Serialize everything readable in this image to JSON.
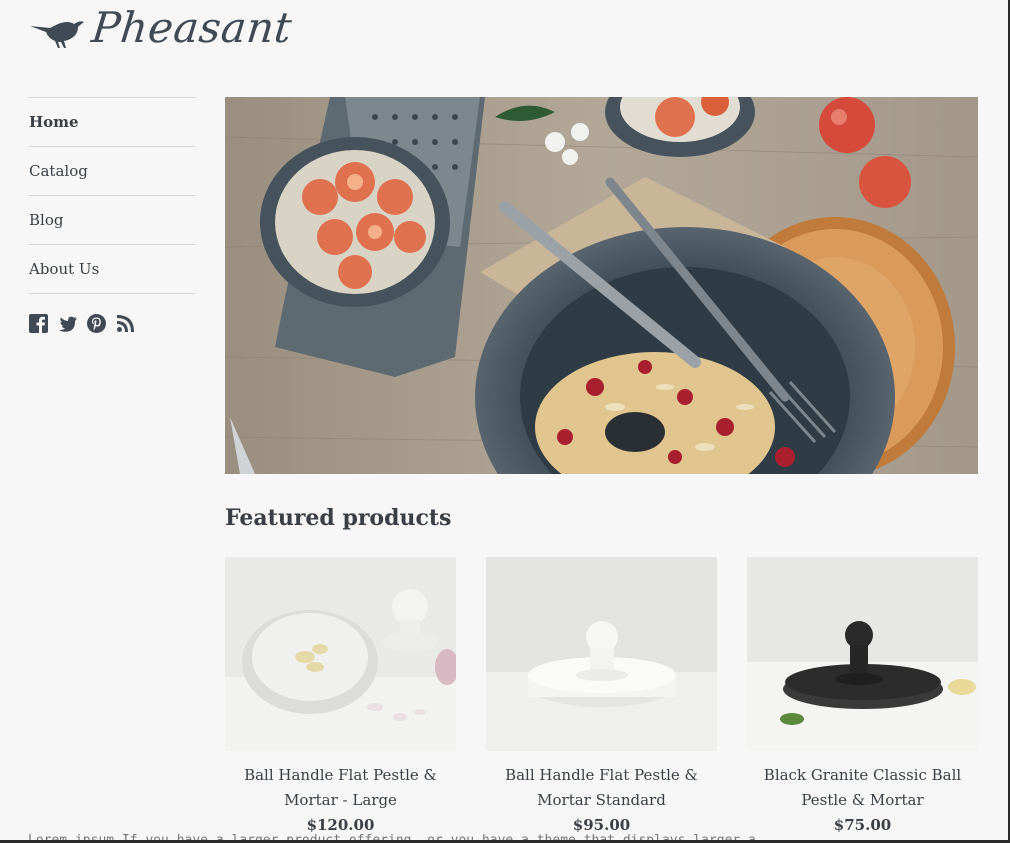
{
  "brand": {
    "name": "Pheasant",
    "logo_icon": "pheasant-bird-icon"
  },
  "nav": {
    "items": [
      {
        "label": "Home",
        "active": true
      },
      {
        "label": "Catalog",
        "active": false
      },
      {
        "label": "Blog",
        "active": false
      },
      {
        "label": "About Us",
        "active": false
      }
    ]
  },
  "social": {
    "icons": [
      "facebook-icon",
      "twitter-icon",
      "pinterest-icon",
      "rss-icon"
    ]
  },
  "hero": {
    "image": "breakfast-table-hero-image"
  },
  "featured": {
    "title": "Featured products",
    "products": [
      {
        "name": "Ball Handle Flat Pestle & Mortar - Large",
        "price": "$120.00"
      },
      {
        "name": "Ball Handle Flat Pestle & Mortar Standard",
        "price": "$95.00"
      },
      {
        "name": "Black Granite Classic Ball Pestle & Mortar",
        "price": "$75.00"
      }
    ]
  },
  "footer_cutoff": {
    "text": "Lorem ipsum          If you have a larger product offering, or you have a theme that displays larger a"
  },
  "colors": {
    "background": "#f7f7f7",
    "text": "#3a3f45",
    "divider": "#d8d8d8"
  }
}
